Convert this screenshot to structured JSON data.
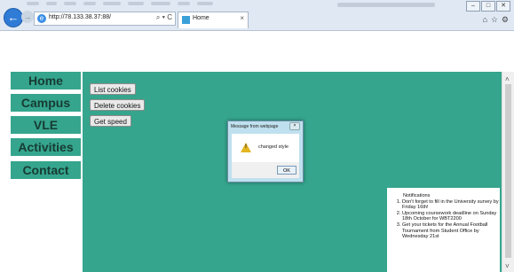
{
  "browser": {
    "url": "http://78.133.38.37:88/",
    "tab_title": "Home",
    "back_glyph": "←",
    "forward_glyph": "→",
    "address_controls": "⌕ ▾ C",
    "tab_close": "×",
    "window_controls": [
      "–",
      "□",
      "✕"
    ],
    "toolbar_icons": [
      "⌂",
      "☆",
      "⚙"
    ]
  },
  "nav": {
    "items": [
      {
        "label": "Home"
      },
      {
        "label": "Campus"
      },
      {
        "label": "VLE"
      },
      {
        "label": "Activities"
      },
      {
        "label": "Contact"
      }
    ]
  },
  "actions": {
    "list_cookies": "List cookies",
    "delete_cookies": "Delete cookies",
    "get_speed": "Get speed"
  },
  "notifications": {
    "heading": "Notifications",
    "items": [
      "Don't forget to fill in the University survey by Friday 16th!",
      "Upcoming coursework deadline on Sunday 18th October for WBT2200",
      "Get your tickets for the Annual Football Tournament from Student Office by Wednesday 21st"
    ]
  },
  "dialog": {
    "title": "Message from webpage",
    "message": "changed style",
    "ok_label": "OK",
    "close_glyph": "×",
    "warning_glyph": "!"
  },
  "scrollbar": {
    "up_glyph": "˄",
    "down_glyph": "˅"
  },
  "colors": {
    "teal": "#35a58d",
    "nav_text": "#173b33"
  }
}
